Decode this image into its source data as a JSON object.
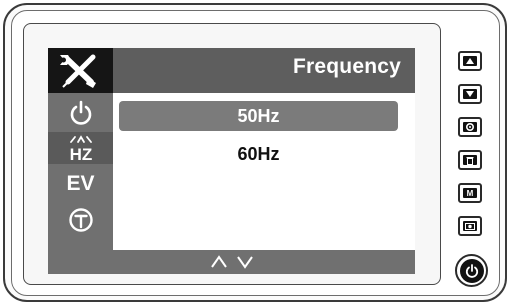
{
  "screen": {
    "title": "Frequency",
    "options": [
      {
        "label": "50Hz",
        "selected": true
      },
      {
        "label": "60Hz",
        "selected": false
      }
    ]
  },
  "sidebar": {
    "items": [
      {
        "icon": "power-icon"
      },
      {
        "icon": "hz-flicker-icon",
        "label": "HZ"
      },
      {
        "icon": "ev-icon",
        "label": "EV"
      },
      {
        "icon": "info-icon"
      }
    ]
  },
  "footer": {
    "nav": "up-down-arrows-icon"
  },
  "hardware_buttons": [
    {
      "icon": "up-arrow-icon"
    },
    {
      "icon": "down-arrow-icon"
    },
    {
      "icon": "gear-icon"
    },
    {
      "icon": "trash-icon"
    },
    {
      "icon": "mode-icon",
      "label": "M"
    },
    {
      "icon": "camera-icon"
    },
    {
      "icon": "power-icon"
    }
  ],
  "colors": {
    "header_bg": "#5e5e5e",
    "tool_cell_bg": "#151515",
    "sidebar_bg": "#707070",
    "selected_option_bg": "#7b7b7b"
  }
}
